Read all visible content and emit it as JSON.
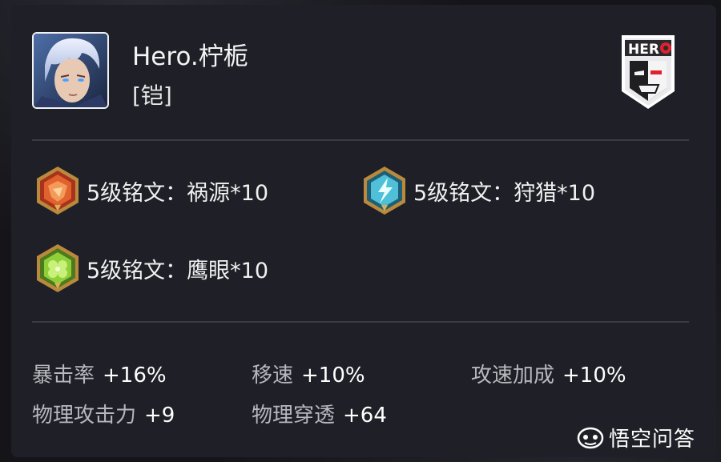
{
  "hero": {
    "name": "Hero.柠栀",
    "role": "[铠]"
  },
  "runes": [
    {
      "text": "5级铭文：祸源*10",
      "color": "#e0632e",
      "icon": "red-rune-icon"
    },
    {
      "text": "5级铭文：狩猎*10",
      "color": "#4fc0d8",
      "icon": "blue-rune-icon"
    },
    {
      "text": "5级铭文：鹰眼*10",
      "color": "#8fcf3a",
      "icon": "green-rune-icon"
    }
  ],
  "stats": [
    {
      "label": "暴击率",
      "value": "+16%"
    },
    {
      "label": "移速",
      "value": "+10%"
    },
    {
      "label": "攻速加成",
      "value": "+10%"
    },
    {
      "label": "物理攻击力",
      "value": "+9"
    },
    {
      "label": "物理穿透",
      "value": "+64"
    }
  ],
  "logo": {
    "text": "HERO",
    "accent": "#e0222e"
  },
  "watermark": {
    "text": "悟空问答"
  }
}
